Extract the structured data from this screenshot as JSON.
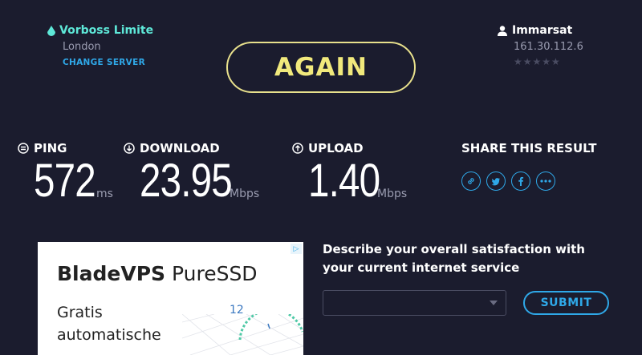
{
  "server": {
    "name": "Vorboss Limite",
    "location": "London",
    "change_label": "CHANGE SERVER",
    "icon": "location-drop-icon"
  },
  "isp": {
    "name": "Immarsat",
    "ip": "161.30.112.6",
    "rating_stars": "★★★★★",
    "rating": 0,
    "icon": "person-icon"
  },
  "again_label": "AGAIN",
  "metrics": {
    "ping": {
      "label": "PING",
      "value": "572",
      "unit": "ms",
      "icon": "ping-icon"
    },
    "download": {
      "label": "DOWNLOAD",
      "value": "23.95",
      "unit": "Mbps",
      "icon": "download-arrow-icon"
    },
    "upload": {
      "label": "UPLOAD",
      "value": "1.40",
      "unit": "Mbps",
      "icon": "upload-arrow-icon"
    }
  },
  "share": {
    "label": "SHARE THIS RESULT",
    "buttons": [
      "link-icon",
      "twitter-icon",
      "facebook-icon",
      "more-icon"
    ]
  },
  "ad": {
    "title_bold": "BladeVPS",
    "title_rest": " PureSSD",
    "body_line1": "Gratis",
    "body_line2": "automatische",
    "number": "12",
    "badge": "▷"
  },
  "survey": {
    "question": "Describe your overall satisfaction with your current internet service",
    "select_value": "",
    "submit_label": "SUBMIT"
  },
  "colors": {
    "background": "#1b1c2e",
    "accent_blue": "#2fa8e8",
    "accent_teal": "#5ee8d8",
    "again_yellow": "#f1e97c"
  }
}
